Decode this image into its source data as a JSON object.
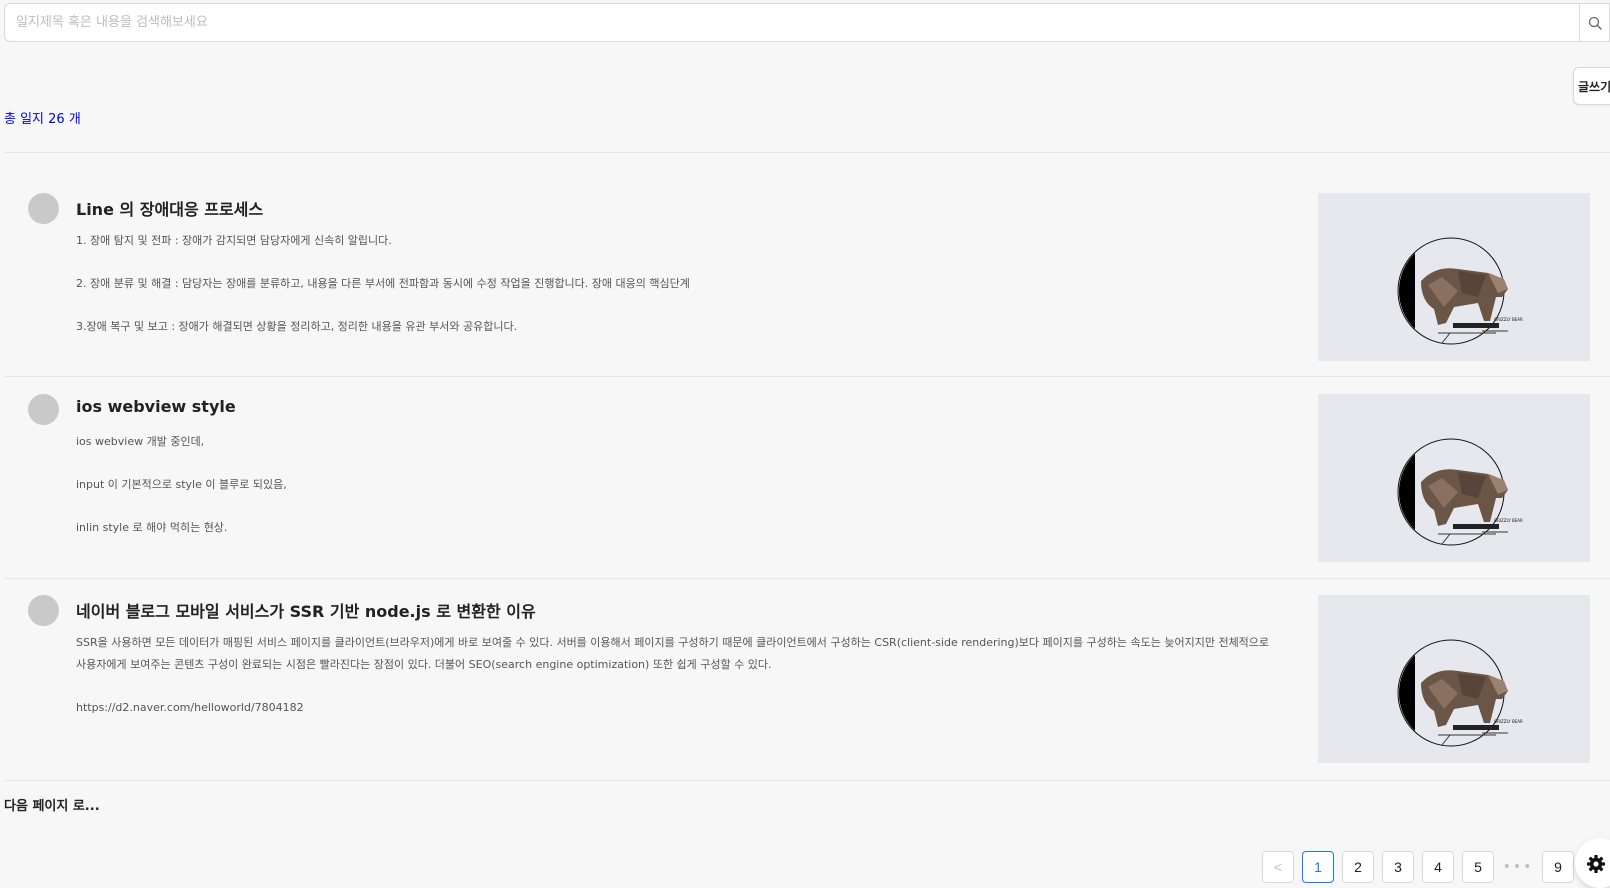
{
  "search": {
    "placeholder": "일지제목 혹은 내용을 검색해보세요",
    "value": ""
  },
  "write_label": "글쓰기",
  "total_count": "총 일지 26 개",
  "posts": [
    {
      "title": "Line 의 장애대응 프로세스",
      "lines": [
        "1. 장애 탐지 및 전파 : 장애가 감지되면 담당자에게 신속히 알립니다.",
        "2. 장애 분류 및 해결 : 담당자는 장애를 분류하고, 내용을 다른 부서에 전파함과 동시에 수정 작업을 진행합니다. 장애 대응의 핵심단계",
        "3.장애 복구 및 보고 : 장애가 해결되면 상황을 정리하고, 정리한 내용을 유관 부서와 공유합니다."
      ],
      "thumb_text": "GRIZZLY BEAR"
    },
    {
      "title": "ios webview style",
      "lines": [
        "ios webview 개발 중인데,",
        "input 이 기본적으로 style 이 블루로 되있음,",
        "inlin style 로 해야 먹히는 현상."
      ],
      "thumb_text": "GRIZZLY BEAR"
    },
    {
      "title": "네이버 블로그 모바일 서비스가 SSR 기반 node.js 로 변환한 이유",
      "lines": [
        "SSR을 사용하면 모든 데이터가 매핑된 서비스 페이지를 클라이언트(브라우저)에게 바로 보여줄 수 있다. 서버를 이용해서 페이지를 구성하기 때문에 클라이언트에서 구성하는 CSR(client-side rendering)보다 페이지를 구성하는 속도는 늦어지지만 전체적으로 사용자에게 보여주는 콘텐츠 구성이 완료되는 시점은 빨라진다는 장점이 있다. 더불어 SEO(search engine optimization) 또한 쉽게 구성할 수 있다.",
        "https://d2.naver.com/helloworld/7804182"
      ],
      "thumb_text": "GRIZZLY BEAR"
    }
  ],
  "next_page": "다음 페이지 로...",
  "pagination": {
    "prev": "<",
    "pages": [
      "1",
      "2",
      "3",
      "4",
      "5"
    ],
    "ellipsis": "•••",
    "last": "9",
    "current": "1"
  },
  "icons": {
    "search": "search-icon",
    "settings": "gear-icon",
    "avatar": "avatar",
    "thumbnail": "grizzly-bear-logo"
  },
  "colors": {
    "total_count": "#0000ee",
    "active_page": "#1677ff",
    "avatar": "#c9c9c9",
    "thumb_bg": "#e6e8ed"
  }
}
